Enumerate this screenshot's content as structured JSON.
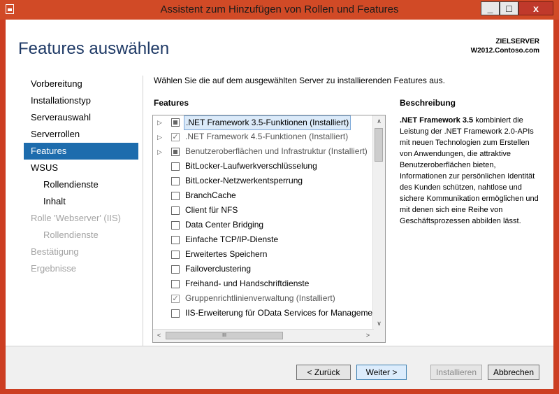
{
  "window": {
    "title": "Assistent zum Hinzufügen von Rollen und Features",
    "minimize": "_",
    "maximize": "□",
    "close": "x"
  },
  "header": {
    "page_title": "Features auswählen",
    "server_label": "ZIELSERVER",
    "server_name": "W2012.Contoso.com"
  },
  "nav": {
    "items": [
      {
        "label": "Vorbereitung",
        "state": "normal"
      },
      {
        "label": "Installationstyp",
        "state": "normal"
      },
      {
        "label": "Serverauswahl",
        "state": "normal"
      },
      {
        "label": "Serverrollen",
        "state": "normal"
      },
      {
        "label": "Features",
        "state": "active"
      },
      {
        "label": "WSUS",
        "state": "normal"
      },
      {
        "label": "Rollendienste",
        "state": "sub"
      },
      {
        "label": "Inhalt",
        "state": "sub"
      },
      {
        "label": "Rolle 'Webserver' (IIS)",
        "state": "disabled"
      },
      {
        "label": "Rollendienste",
        "state": "disabled-sub"
      },
      {
        "label": "Bestätigung",
        "state": "disabled"
      },
      {
        "label": "Ergebnisse",
        "state": "disabled"
      }
    ]
  },
  "main": {
    "instruction": "Wählen Sie die auf dem ausgewählten Server zu installierenden Features aus.",
    "features_heading": "Features",
    "features": [
      {
        "label": ".NET Framework 3.5-Funktionen (Installiert)",
        "expander": "▷",
        "check": "partial"
      },
      {
        "label": ".NET Framework 4.5-Funktionen (Installiert)",
        "expander": "▷",
        "check": "checked"
      },
      {
        "label": "Benutzeroberflächen und Infrastruktur (Installiert)",
        "expander": "▷",
        "check": "partial"
      },
      {
        "label": "BitLocker-Laufwerkverschlüsselung",
        "expander": "",
        "check": "none"
      },
      {
        "label": "BitLocker-Netzwerkentsperrung",
        "expander": "",
        "check": "none"
      },
      {
        "label": "BranchCache",
        "expander": "",
        "check": "none"
      },
      {
        "label": "Client für NFS",
        "expander": "",
        "check": "none"
      },
      {
        "label": "Data Center Bridging",
        "expander": "",
        "check": "none"
      },
      {
        "label": "Einfache TCP/IP-Dienste",
        "expander": "",
        "check": "none"
      },
      {
        "label": "Erweitertes Speichern",
        "expander": "",
        "check": "none"
      },
      {
        "label": "Failoverclustering",
        "expander": "",
        "check": "none"
      },
      {
        "label": "Freihand- und Handschriftdienste",
        "expander": "",
        "check": "none"
      },
      {
        "label": "Gruppenrichtlinienverwaltung (Installiert)",
        "expander": "",
        "check": "checked"
      },
      {
        "label": "IIS-Erweiterung für OData Services for Manageme",
        "expander": "",
        "check": "none"
      }
    ],
    "scroll_up": "∧",
    "scroll_down": "∨",
    "scroll_left": "<",
    "scroll_right": ">",
    "hthumb_grip": "III",
    "vthumb_grip": "≡"
  },
  "description": {
    "heading": "Beschreibung",
    "highlight": ".NET Framework 3.5",
    "text": " kombiniert die Leistung der .NET Framework 2.0-APIs mit neuen Technologien zum Erstellen von Anwendungen, die attraktive Benutzeroberflächen bieten, Informationen zur persönlichen Identität des Kunden schützen, nahtlose und sichere Kommunikation ermöglichen und mit denen sich eine Reihe von Geschäftsprozessen abbilden lässt."
  },
  "footer": {
    "back": "< Zurück",
    "next": "Weiter >",
    "install": "Installieren",
    "cancel": "Abbrechen"
  }
}
